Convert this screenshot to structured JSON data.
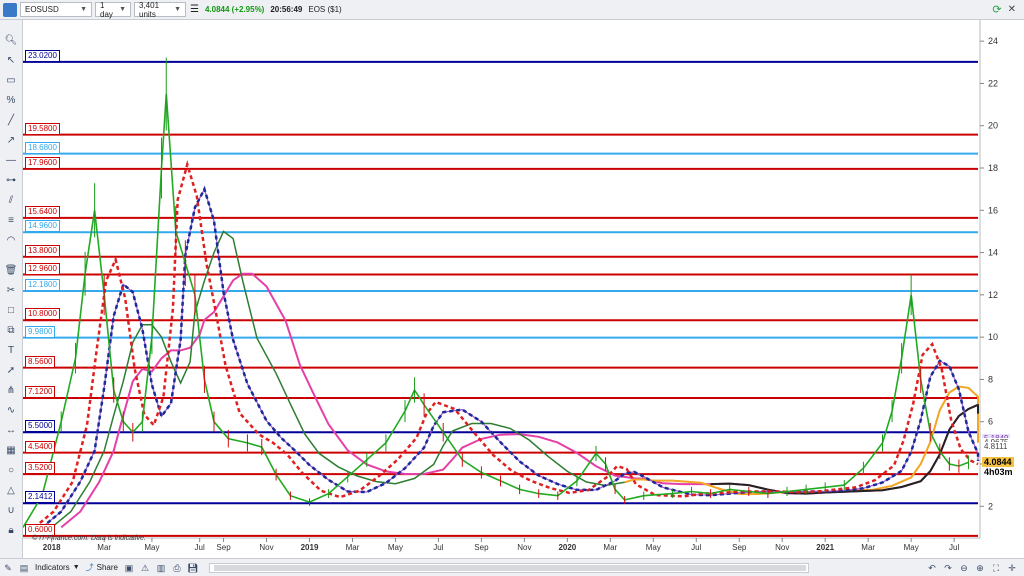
{
  "toolbar": {
    "symbol": "EOSUSD",
    "interval": "1 day",
    "units": "3,401 units",
    "price": "4.0844 (+2.95%)",
    "time": "20:56:49",
    "instrument": "EOS ($1)"
  },
  "bottom": {
    "indicators_label": "Indicators",
    "share_label": "Share",
    "copyright": "© IT-Finance.com. Data is indicative."
  },
  "colors": {
    "blue_level": "#000099",
    "red_level": "#cc0000",
    "cyan_level": "#33aaee"
  },
  "levels": [
    {
      "value": 23.02,
      "label": "23.0200",
      "color": "blue"
    },
    {
      "value": 19.58,
      "label": "19.5800",
      "color": "red"
    },
    {
      "value": 18.68,
      "label": "18.6800",
      "color": "cyan"
    },
    {
      "value": 17.96,
      "label": "17.9600",
      "color": "red"
    },
    {
      "value": 15.64,
      "label": "15.6400",
      "color": "red"
    },
    {
      "value": 14.96,
      "label": "14.9600",
      "color": "cyan"
    },
    {
      "value": 13.8,
      "label": "13.8000",
      "color": "red"
    },
    {
      "value": 12.96,
      "label": "12.9600",
      "color": "red"
    },
    {
      "value": 12.18,
      "label": "12.1800",
      "color": "cyan"
    },
    {
      "value": 10.8,
      "label": "10.8000",
      "color": "red"
    },
    {
      "value": 9.98,
      "label": "9.9800",
      "color": "cyan"
    },
    {
      "value": 8.56,
      "label": "8.5600",
      "color": "red"
    },
    {
      "value": 7.12,
      "label": "7.1200",
      "color": "red"
    },
    {
      "value": 5.5,
      "label": "5.5000",
      "color": "blue"
    },
    {
      "value": 4.54,
      "label": "4.5400",
      "color": "red"
    },
    {
      "value": 3.52,
      "label": "3.5200",
      "color": "red"
    },
    {
      "value": 2.1412,
      "label": "2.1412",
      "color": "blue"
    },
    {
      "value": 0.6,
      "label": "0.6000",
      "color": "red"
    }
  ],
  "chart_data": {
    "type": "line",
    "y_ticks": [
      2,
      4,
      6,
      8,
      10,
      12,
      14,
      16,
      18,
      20,
      22,
      24
    ],
    "ylim": [
      0.5,
      25
    ],
    "x_ticks": [
      "2018",
      "Mar",
      "May",
      "Jul",
      "Sep",
      "Nov",
      "2019",
      "Mar",
      "May",
      "Jul",
      "Sep",
      "Nov",
      "2020",
      "Mar",
      "May",
      "Jul",
      "Sep",
      "Nov",
      "2021",
      "Mar",
      "May",
      "Jul"
    ],
    "x_tick_pos": [
      0.03,
      0.085,
      0.135,
      0.185,
      0.21,
      0.255,
      0.3,
      0.345,
      0.39,
      0.435,
      0.48,
      0.525,
      0.57,
      0.615,
      0.66,
      0.705,
      0.75,
      0.795,
      0.84,
      0.885,
      0.93,
      0.975
    ],
    "price_series": [
      [
        0.0,
        1.0
      ],
      [
        0.02,
        2.5
      ],
      [
        0.04,
        6.0
      ],
      [
        0.055,
        9.0
      ],
      [
        0.065,
        13.0
      ],
      [
        0.075,
        16.0
      ],
      [
        0.085,
        12.0
      ],
      [
        0.095,
        7.5
      ],
      [
        0.105,
        6.0
      ],
      [
        0.115,
        5.5
      ],
      [
        0.125,
        6.0
      ],
      [
        0.135,
        10.0
      ],
      [
        0.145,
        18.0
      ],
      [
        0.15,
        21.5
      ],
      [
        0.16,
        15.0
      ],
      [
        0.17,
        13.5
      ],
      [
        0.18,
        12.0
      ],
      [
        0.19,
        8.0
      ],
      [
        0.2,
        6.0
      ],
      [
        0.215,
        5.2
      ],
      [
        0.235,
        5.0
      ],
      [
        0.25,
        4.8
      ],
      [
        0.265,
        3.5
      ],
      [
        0.28,
        2.5
      ],
      [
        0.3,
        2.2
      ],
      [
        0.32,
        2.6
      ],
      [
        0.34,
        3.4
      ],
      [
        0.36,
        4.2
      ],
      [
        0.38,
        5.0
      ],
      [
        0.4,
        6.5
      ],
      [
        0.41,
        7.5
      ],
      [
        0.42,
        6.8
      ],
      [
        0.44,
        5.5
      ],
      [
        0.46,
        4.2
      ],
      [
        0.48,
        3.6
      ],
      [
        0.5,
        3.2
      ],
      [
        0.52,
        2.8
      ],
      [
        0.54,
        2.6
      ],
      [
        0.56,
        2.5
      ],
      [
        0.58,
        3.2
      ],
      [
        0.6,
        4.5
      ],
      [
        0.61,
        4.0
      ],
      [
        0.62,
        2.8
      ],
      [
        0.63,
        2.3
      ],
      [
        0.65,
        2.5
      ],
      [
        0.68,
        2.6
      ],
      [
        0.7,
        2.7
      ],
      [
        0.72,
        2.6
      ],
      [
        0.74,
        2.8
      ],
      [
        0.76,
        2.7
      ],
      [
        0.78,
        2.6
      ],
      [
        0.8,
        2.7
      ],
      [
        0.82,
        2.8
      ],
      [
        0.84,
        2.9
      ],
      [
        0.86,
        3.0
      ],
      [
        0.88,
        3.8
      ],
      [
        0.9,
        5.0
      ],
      [
        0.91,
        6.5
      ],
      [
        0.92,
        9.0
      ],
      [
        0.93,
        12.0
      ],
      [
        0.94,
        8.0
      ],
      [
        0.95,
        5.5
      ],
      [
        0.96,
        4.6
      ],
      [
        0.97,
        4.0
      ],
      [
        0.98,
        3.9
      ],
      [
        0.99,
        4.08
      ]
    ],
    "right_labels": [
      "5.1849",
      "4.9675",
      "4.8111",
      "4.0844",
      "4h03m"
    ]
  }
}
